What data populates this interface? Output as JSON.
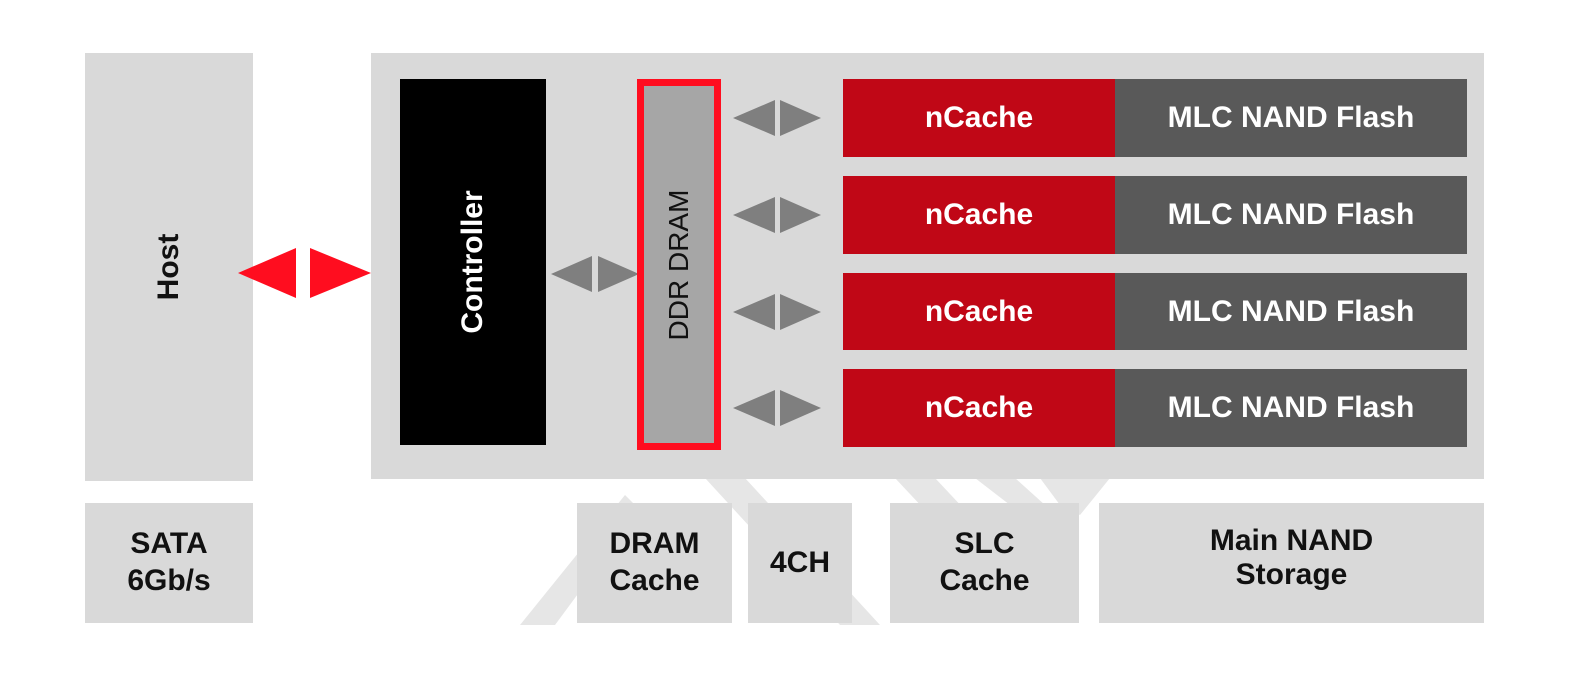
{
  "diagram": {
    "host": {
      "label": "Host"
    },
    "controller": {
      "label": "Controller"
    },
    "dram": {
      "label": "DDR DRAM"
    },
    "channels": [
      {
        "cache": "nCache",
        "flash": "MLC NAND Flash"
      },
      {
        "cache": "nCache",
        "flash": "MLC NAND Flash"
      },
      {
        "cache": "nCache",
        "flash": "MLC NAND Flash"
      },
      {
        "cache": "nCache",
        "flash": "MLC NAND Flash"
      }
    ],
    "bottom_labels": {
      "interface": "SATA\n6Gb/s",
      "dram_cache": "DRAM\nCache",
      "channels": "4CH",
      "slc_cache": "SLC\nCache",
      "main_storage": "Main NAND\nStorage"
    },
    "colors": {
      "panel": "#d9d9d9",
      "controller": "#000000",
      "dram_fill": "#a6a6a6",
      "accent_red": "#ff0d1f",
      "ncache": "#c00716",
      "flash": "#595959",
      "arrow_gray": "#7f7f7f"
    }
  }
}
